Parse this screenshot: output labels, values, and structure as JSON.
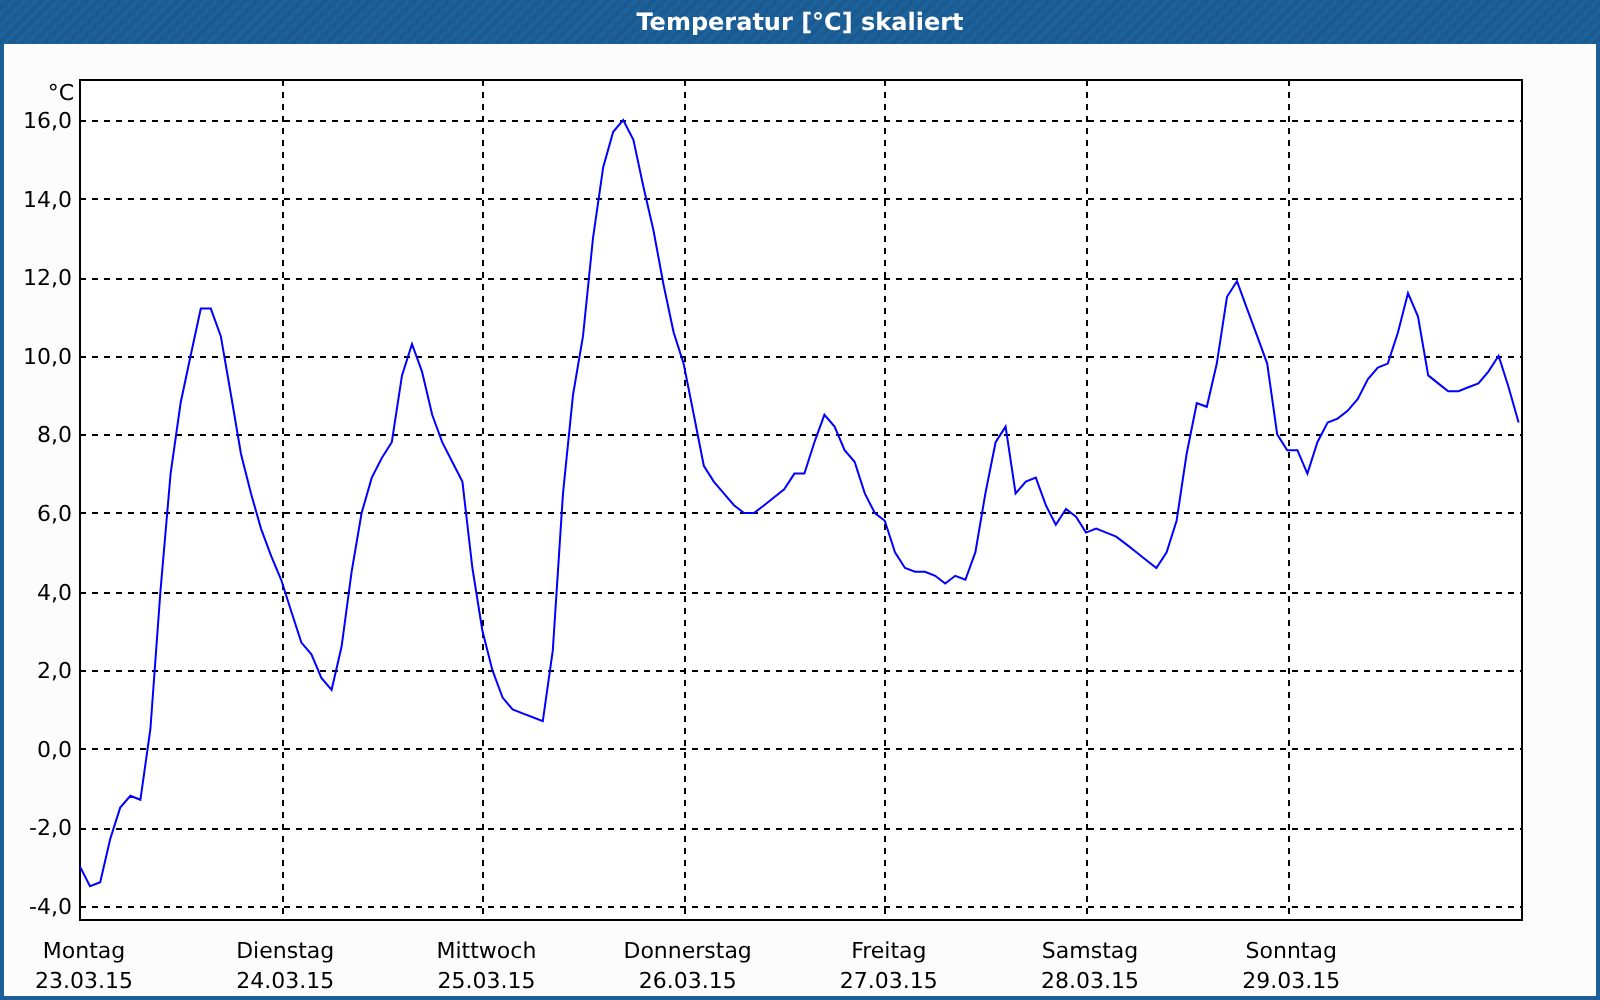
{
  "window": {
    "title": "Temperatur [°C] skaliert"
  },
  "chart": {
    "chart_data": {
      "type": "line",
      "grid": true,
      "ylabel": "°C",
      "ylim": [
        -4.36,
        17.02
      ],
      "yticks": [
        {
          "value": -4,
          "label": "-4,0"
        },
        {
          "value": -2,
          "label": "-2,0"
        },
        {
          "value": 0,
          "label": "0,0"
        },
        {
          "value": 2,
          "label": "2,0"
        },
        {
          "value": 4,
          "label": "4,0"
        },
        {
          "value": 6,
          "label": "6,0"
        },
        {
          "value": 8,
          "label": "8,0"
        },
        {
          "value": 10,
          "label": "10,0"
        },
        {
          "value": 12,
          "label": "12,0"
        },
        {
          "value": 14,
          "label": "14,0"
        },
        {
          "value": 16,
          "label": "16,0"
        }
      ],
      "categories": [
        "Montag\n23.03.15",
        null,
        null,
        null,
        null,
        null,
        null,
        null,
        null,
        null,
        null,
        null,
        null,
        null,
        null,
        null,
        null,
        null,
        null,
        null,
        "Dienstag\n24.03.15",
        null,
        null,
        null,
        null,
        null,
        null,
        null,
        null,
        null,
        null,
        null,
        null,
        null,
        null,
        null,
        null,
        null,
        null,
        null,
        "Mittwoch\n25.03.15",
        null,
        null,
        null,
        null,
        null,
        null,
        null,
        null,
        null,
        null,
        null,
        null,
        null,
        null,
        null,
        null,
        null,
        null,
        null,
        "Donnerstag\n26.03.15",
        null,
        null,
        null,
        null,
        null,
        null,
        null,
        null,
        null,
        null,
        null,
        null,
        null,
        null,
        null,
        null,
        null,
        null,
        null,
        "Freitag\n27.03.15",
        null,
        null,
        null,
        null,
        null,
        null,
        null,
        null,
        null,
        null,
        null,
        null,
        null,
        null,
        null,
        null,
        null,
        null,
        null,
        "Samstag\n28.03.15",
        null,
        null,
        null,
        null,
        null,
        null,
        null,
        null,
        null,
        null,
        null,
        null,
        null,
        null,
        null,
        null,
        null,
        null,
        null,
        "Sonntag\n29.03.15",
        null,
        null,
        null,
        null,
        null,
        null,
        null,
        null,
        null,
        null,
        null,
        null,
        null,
        null,
        null,
        null,
        null,
        null,
        null,
        null,
        null,
        null,
        null
      ],
      "series": [
        {
          "color": "#0000ff",
          "values": [
            -3.0,
            -3.5,
            -3.4,
            -2.3,
            -1.5,
            -1.2,
            -1.3,
            0.5,
            4.0,
            7.0,
            8.8,
            10.0,
            11.2,
            11.2,
            10.5,
            9.0,
            7.5,
            6.5,
            5.6,
            4.9,
            4.3,
            3.5,
            2.7,
            2.4,
            1.8,
            1.5,
            2.6,
            4.5,
            6.0,
            6.9,
            7.4,
            7.8,
            9.5,
            10.3,
            9.6,
            8.5,
            7.8,
            7.3,
            6.8,
            4.6,
            3.0,
            2.0,
            1.3,
            1.0,
            0.9,
            0.8,
            0.7,
            2.5,
            6.5,
            9.0,
            10.5,
            13.0,
            14.8,
            15.7,
            16.0,
            15.5,
            14.3,
            13.2,
            11.8,
            10.6,
            9.8,
            8.5,
            7.2,
            6.8,
            6.5,
            6.2,
            6.0,
            6.0,
            6.2,
            6.4,
            6.6,
            7.0,
            7.0,
            7.8,
            8.5,
            8.2,
            7.6,
            7.3,
            6.5,
            6.0,
            5.8,
            5.0,
            4.6,
            4.5,
            4.5,
            4.4,
            4.2,
            4.4,
            4.3,
            5.0,
            6.5,
            7.8,
            8.2,
            6.5,
            6.8,
            6.9,
            6.2,
            5.7,
            6.1,
            5.9,
            5.5,
            5.6,
            5.5,
            5.4,
            5.2,
            5.0,
            4.8,
            4.6,
            5.0,
            5.8,
            7.5,
            8.8,
            8.7,
            9.8,
            11.5,
            11.9,
            11.2,
            10.5,
            9.8,
            8.0,
            7.6,
            7.6,
            7.0,
            7.8,
            8.3,
            8.4,
            8.6,
            8.9,
            9.4,
            9.7,
            9.8,
            10.6,
            11.6,
            11.0,
            9.5,
            9.3,
            9.1,
            9.1,
            9.2,
            9.3,
            9.6,
            10.0,
            9.2,
            8.3
          ]
        }
      ]
    }
  }
}
